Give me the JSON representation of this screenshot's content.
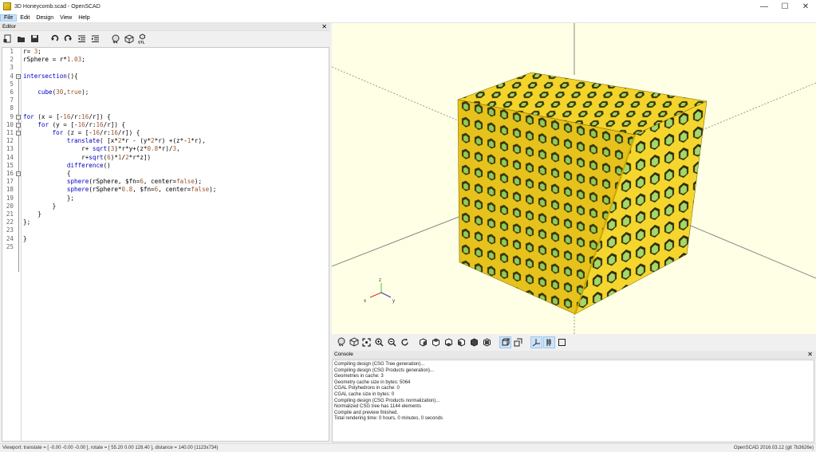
{
  "window": {
    "title": "3D Honeycomb.scad - OpenSCAD",
    "controls": {
      "minimize": "—",
      "maximize": "☐",
      "close": "✕"
    }
  },
  "menubar": {
    "items": [
      "File",
      "Edit",
      "Design",
      "View",
      "Help"
    ]
  },
  "editor": {
    "dock_title": "Editor",
    "close_glyph": "✕",
    "toolbar_icons": [
      "new-file-icon",
      "open-file-icon",
      "save-icon",
      "undo-icon",
      "redo-icon",
      "unindent-icon",
      "indent-icon",
      "preview-icon",
      "render-icon",
      "export-stl-icon"
    ],
    "lines": [
      {
        "n": "1",
        "text": "r= 3;"
      },
      {
        "n": "2",
        "text": "rSphere = r*1.03;"
      },
      {
        "n": "3",
        "text": ""
      },
      {
        "n": "4",
        "text": "intersection(){"
      },
      {
        "n": "5",
        "text": ""
      },
      {
        "n": "6",
        "text": "    cube(30,true);"
      },
      {
        "n": "7",
        "text": ""
      },
      {
        "n": "8",
        "text": ""
      },
      {
        "n": "9",
        "text": "for (x = [-16/r:16/r]) {"
      },
      {
        "n": "10",
        "text": "    for (y = [-16/r:16/r]) {"
      },
      {
        "n": "11",
        "text": "        for (z = [-16/r:16/r]) {"
      },
      {
        "n": "12",
        "text": "            translate( [x*2*r - (y*2*r) +(z*-1*r),"
      },
      {
        "n": "13",
        "text": "                r+ sqrt(3)*r*y+(z*0.8*r)/3,"
      },
      {
        "n": "14",
        "text": "                r+sqrt(6)*1/2*r*z])"
      },
      {
        "n": "15",
        "text": "            difference()"
      },
      {
        "n": "16",
        "text": "            {"
      },
      {
        "n": "17",
        "text": "            sphere(rSphere, $fn=6, center=false);"
      },
      {
        "n": "18",
        "text": "            sphere(rSphere*0.8, $fn=6, center=false);"
      },
      {
        "n": "19",
        "text": "            };"
      },
      {
        "n": "20",
        "text": "        }"
      },
      {
        "n": "21",
        "text": "    }"
      },
      {
        "n": "22",
        "text": "};"
      },
      {
        "n": "23",
        "text": ""
      },
      {
        "n": "24",
        "text": "}"
      },
      {
        "n": "25",
        "text": ""
      }
    ]
  },
  "viewport": {
    "background": "#ffffe5",
    "mesh_face_color": "#f2d42a",
    "mesh_inner_color": "#9ed36a",
    "axes_labels": {
      "x": "x",
      "y": "y",
      "z": "z"
    }
  },
  "view_toolbar": {
    "icons": [
      "preview-icon",
      "render-icon",
      "view-all-icon",
      "zoom-in-icon",
      "zoom-out-icon",
      "reset-view-icon",
      "right-view-icon",
      "top-view-icon",
      "bottom-view-icon",
      "left-view-icon",
      "front-view-icon",
      "back-view-icon",
      "perspective-icon",
      "orthogonal-icon",
      "show-axes-icon",
      "show-scale-icon",
      "show-edges-icon"
    ]
  },
  "console": {
    "dock_title": "Console",
    "close_glyph": "✕",
    "lines": [
      "Compiling design (CSG Tree generation)...",
      "Compiling design (CSG Products generation)...",
      "Geometries in cache: 3",
      "Geometry cache size in bytes: 5064",
      "CGAL Polyhedrons in cache: 0",
      "CGAL cache size in bytes: 0",
      "Compiling design (CSG Products normalization)...",
      "Normalized CSG tree has 1144 elements",
      "Compile and preview finished.",
      "Total rendering time: 0 hours, 0 minutes, 0 seconds"
    ]
  },
  "statusbar": {
    "left": "Viewport: translate = [ -0.00 -0.00 -0.00 ], rotate = [ 55.20 0.00 128.40 ], distance = 140.00 (1123x734)",
    "right": "OpenSCAD 2016.03.12 (git 7b3626e)"
  }
}
